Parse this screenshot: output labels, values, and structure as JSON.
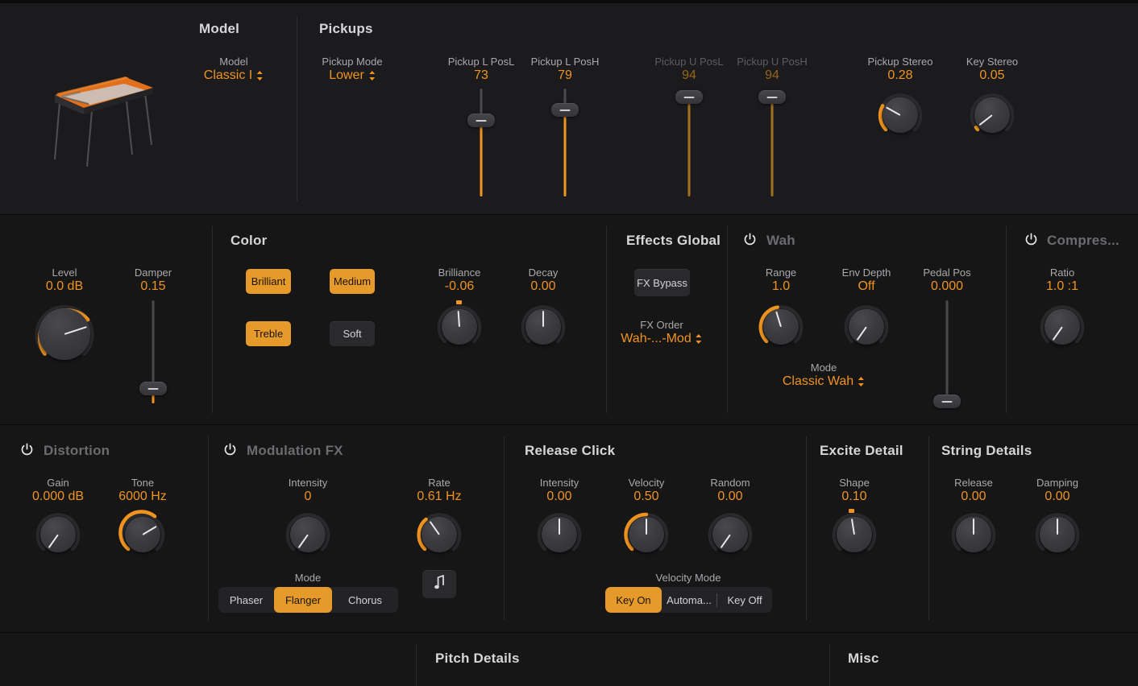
{
  "sections": {
    "model": "Model",
    "pickups": "Pickups",
    "color": "Color",
    "effects_global": "Effects Global",
    "wah": "Wah",
    "compressor": "Compres...",
    "distortion": "Distortion",
    "modulation_fx": "Modulation FX",
    "release_click": "Release Click",
    "excite_detail": "Excite Detail",
    "string_details": "String Details",
    "pitch_details": "Pitch Details",
    "misc": "Misc"
  },
  "model": {
    "label": "Model",
    "value": "Classic I"
  },
  "pickups": {
    "mode_label": "Pickup Mode",
    "mode_value": "Lower",
    "sliders": [
      {
        "label": "Pickup L PosL",
        "value": "73",
        "fill": 73,
        "enabled": true
      },
      {
        "label": "Pickup L PosH",
        "value": "79",
        "fill": 79,
        "enabled": true
      },
      {
        "label": "Pickup U PosL",
        "value": "94",
        "fill": 94,
        "enabled": false
      },
      {
        "label": "Pickup U PosH",
        "value": "94",
        "fill": 94,
        "enabled": false
      }
    ],
    "stereo": {
      "label": "Pickup Stereo",
      "value": "0.28"
    },
    "key_stereo": {
      "label": "Key Stereo",
      "value": "0.05"
    }
  },
  "main": {
    "level": {
      "label": "Level",
      "value": "0.0 dB"
    },
    "damper": {
      "label": "Damper",
      "value": "0.15"
    }
  },
  "color": {
    "buttons": [
      {
        "label": "Brilliant",
        "active": true
      },
      {
        "label": "Medium",
        "active": true
      },
      {
        "label": "Treble",
        "active": true
      },
      {
        "label": "Soft",
        "active": false
      }
    ],
    "brilliance": {
      "label": "Brilliance",
      "value": "-0.06"
    },
    "decay": {
      "label": "Decay",
      "value": "0.00"
    }
  },
  "effects_global": {
    "fx_bypass_label": "FX Bypass",
    "fx_order_label": "FX Order",
    "fx_order_value": "Wah-...-Mod"
  },
  "wah": {
    "enabled": false,
    "range": {
      "label": "Range",
      "value": "1.0"
    },
    "env_depth": {
      "label": "Env Depth",
      "value": "Off"
    },
    "pedal_pos": {
      "label": "Pedal Pos",
      "value": "0.000"
    },
    "mode_label": "Mode",
    "mode_value": "Classic Wah"
  },
  "compressor": {
    "enabled": false,
    "ratio": {
      "label": "Ratio",
      "value": "1.0 :1"
    }
  },
  "distortion": {
    "enabled": false,
    "gain": {
      "label": "Gain",
      "value": "0.000 dB"
    },
    "tone": {
      "label": "Tone",
      "value": "6000 Hz"
    }
  },
  "modulation_fx": {
    "enabled": false,
    "intensity": {
      "label": "Intensity",
      "value": "0"
    },
    "rate": {
      "label": "Rate",
      "value": "0.61 Hz"
    },
    "mode_label": "Mode",
    "mode_items": [
      {
        "label": "Phaser",
        "active": false
      },
      {
        "label": "Flanger",
        "active": true
      },
      {
        "label": "Chorus",
        "active": false
      }
    ],
    "sync_icon": "note-icon"
  },
  "release_click": {
    "intensity": {
      "label": "Intensity",
      "value": "0.00"
    },
    "velocity": {
      "label": "Velocity",
      "value": "0.50"
    },
    "random": {
      "label": "Random",
      "value": "0.00"
    },
    "velocity_mode_label": "Velocity Mode",
    "velocity_mode_items": [
      {
        "label": "Key On",
        "active": true
      },
      {
        "label": "Automa...",
        "active": false
      },
      {
        "label": "Key Off",
        "active": false
      }
    ]
  },
  "excite_detail": {
    "shape": {
      "label": "Shape",
      "value": "0.10"
    }
  },
  "string_details": {
    "release": {
      "label": "Release",
      "value": "0.00"
    },
    "damping": {
      "label": "Damping",
      "value": "0.00"
    }
  },
  "colors": {
    "accent": "#f0941f",
    "accent_button": "#e59a2a",
    "panel": "#1b1b1d",
    "panel_alt": "#161617",
    "label": "#a9a9ad",
    "title": "#d6d6d8",
    "disabled": "#6c6c70"
  }
}
